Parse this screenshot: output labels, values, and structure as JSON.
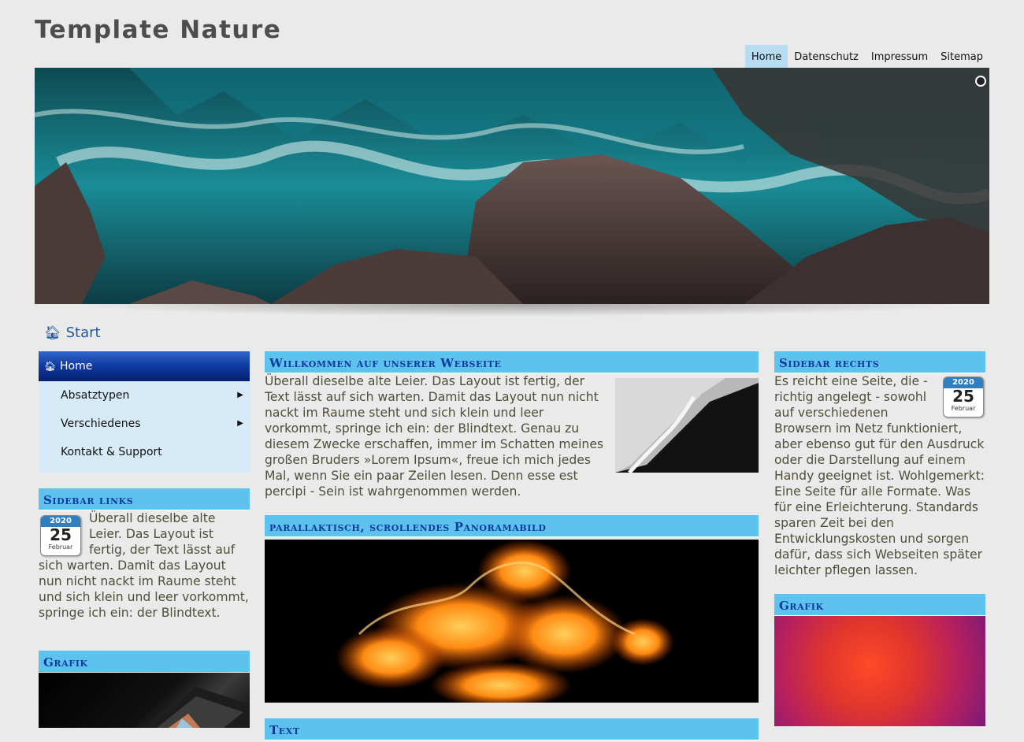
{
  "site": {
    "title": "Template Nature"
  },
  "topnav": [
    "Home",
    "Datenschutz",
    "Impressum",
    "Sitemap"
  ],
  "breadcrumb": {
    "label": "Start"
  },
  "sidebar_left": {
    "menu": [
      {
        "label": "Home",
        "icon": "home-icon",
        "active": true
      },
      {
        "label": "Absatztypen",
        "has_sub": true
      },
      {
        "label": "Verschiedenes",
        "has_sub": true
      },
      {
        "label": "Kontakt & Support",
        "has_sub": false
      }
    ],
    "box_heading": "Sidebar links",
    "calendar": {
      "year": "2020",
      "day": "25",
      "month": "Februar"
    },
    "box_text": "Überall dieselbe alte Leier. Das Layout ist fertig, der Text lässt auf sich warten. Damit das Layout nun nicht nackt im Raume steht und sich klein und leer vorkommt, springe ich ein: der Blindtext.",
    "grafik_heading": "Grafik"
  },
  "main": {
    "welcome_heading": "Willkommen auf unserer Webseite",
    "welcome_text": "Überall dieselbe alte Leier. Das Layout ist fertig, der Text lässt auf sich warten. Damit das Layout nun nicht nackt im Raume steht und sich klein und leer vorkommt, springe ich ein: der Blindtext. Genau zu diesem Zwecke erschaffen, immer im Schatten meines großen Bruders »Lorem Ipsum«, freue ich mich jedes Mal, wenn Sie ein paar Zeilen lesen. Denn esse est percipi - Sein ist wahrgenommen werden.",
    "panorama_heading": "parallaktisch, scrollendes Panoramabild",
    "text_heading": "Text"
  },
  "sidebar_right": {
    "heading": "Sidebar rechts",
    "calendar": {
      "year": "2020",
      "day": "25",
      "month": "Februar"
    },
    "text": "Es reicht eine Seite, die - richtig angelegt - sowohl auf verschiedenen Browsern im Netz funktioniert, aber ebenso gut für den Ausdruck oder die Darstellung auf einem Handy geeignet ist. Wohlgemerkt: Eine Seite für alle Formate. Was für eine Erleichterung. Standards sparen Zeit bei den Entwicklungskosten und sorgen dafür, dass sich Webseiten später leichter pflegen lassen.",
    "grafik_heading": "Grafik"
  },
  "colors": {
    "accent": "#5ec2ef",
    "heading_text": "#0d3b9c",
    "menu_active": "#0d3aa0",
    "menu_bg": "#d6eaf7",
    "nav_active": "#b8dcf2"
  }
}
